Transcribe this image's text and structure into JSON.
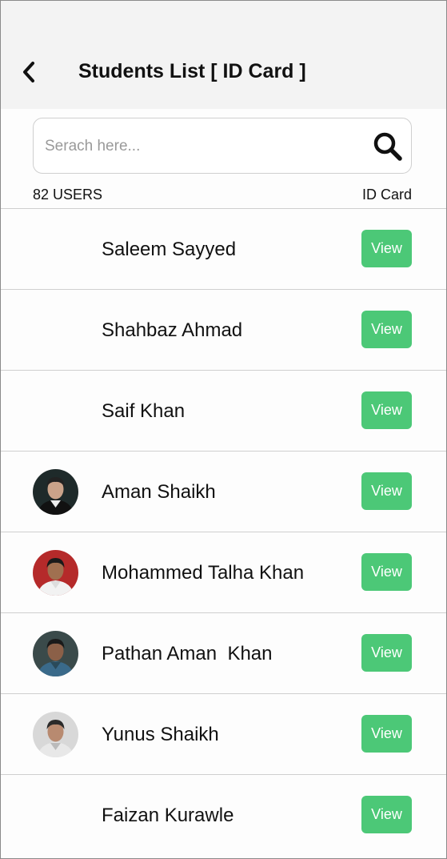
{
  "header": {
    "title": "Students List [ ID Card ]",
    "back_icon": "chevron-left-icon"
  },
  "search": {
    "placeholder": "Serach here...",
    "value": "",
    "icon": "search-icon"
  },
  "meta": {
    "count_label": "82 USERS",
    "column_label": "ID Card"
  },
  "colors": {
    "header_bg": "#f3f3f3",
    "button_green": "#4cc877",
    "divider": "#cfcfcf"
  },
  "students": [
    {
      "name": "Saleem Sayyed",
      "has_photo": false,
      "button": "View"
    },
    {
      "name": "Shahbaz Ahmad",
      "has_photo": false,
      "button": "View"
    },
    {
      "name": "Saif Khan",
      "has_photo": false,
      "button": "View"
    },
    {
      "name": "Aman Shaikh",
      "has_photo": true,
      "button": "View"
    },
    {
      "name": "Mohammed Talha Khan",
      "has_photo": true,
      "button": "View"
    },
    {
      "name": "Pathan Aman  Khan",
      "has_photo": true,
      "button": "View"
    },
    {
      "name": "Yunus Shaikh",
      "has_photo": true,
      "button": "View"
    },
    {
      "name": "Faizan Kurawle",
      "has_photo": false,
      "button": "View"
    }
  ]
}
